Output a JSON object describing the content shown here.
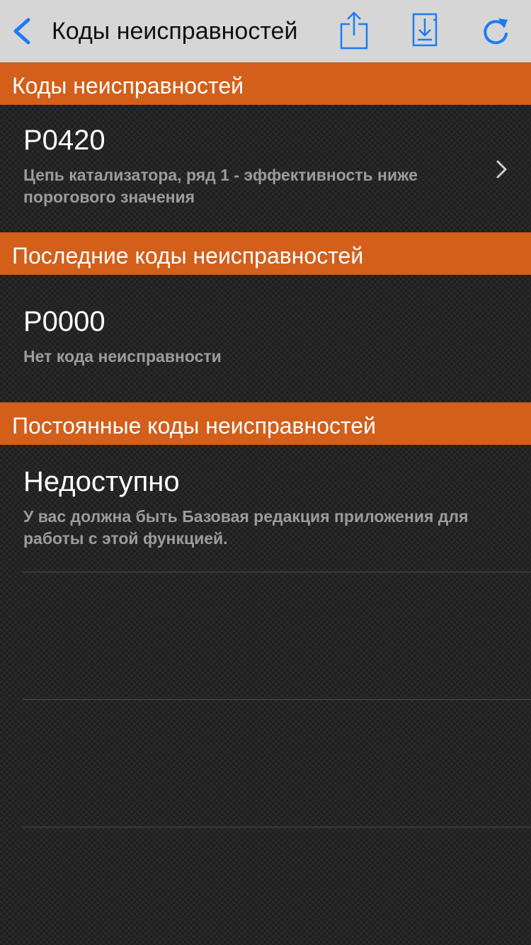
{
  "nav": {
    "title": "Коды неисправностей"
  },
  "sections": [
    {
      "header": "Коды неисправностей",
      "item": {
        "code": "P0420",
        "description": "Цепь катализатора, ряд 1 - эффективность ниже порогового значения"
      }
    },
    {
      "header": "Последние коды неисправностей",
      "item": {
        "code": "P0000",
        "description": "Нет кода неисправности"
      }
    },
    {
      "header": "Постоянные коды неисправностей",
      "item": {
        "code": "Недоступно",
        "description": "У вас должна быть Базовая редакция приложения для работы с этой функцией."
      }
    }
  ],
  "colors": {
    "accent": "#1a7cf5",
    "section_header": "#d35f1b",
    "navbar": "#d6d6d6"
  },
  "icons": {
    "back": "chevron-left-icon",
    "share": "share-icon",
    "save": "save-download-icon",
    "refresh": "refresh-icon",
    "disclosure": "chevron-right-icon"
  }
}
